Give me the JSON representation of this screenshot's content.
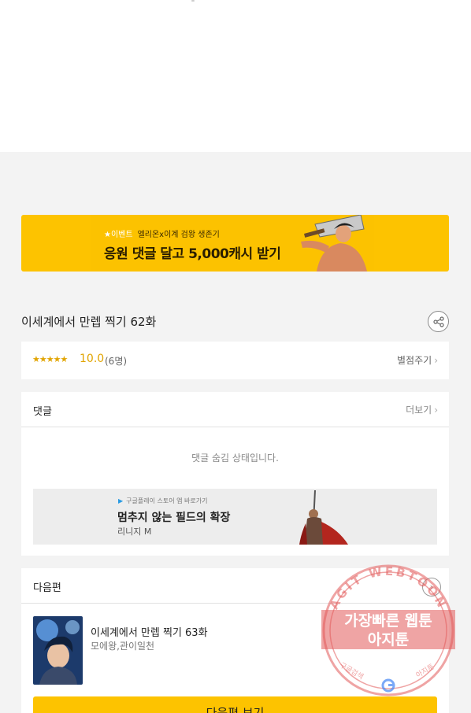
{
  "banner": {
    "tag": "★이벤트",
    "subtitle": "엘리온x이계 검왕 생존기",
    "headline": "응원 댓글 달고 5,000캐시 받기"
  },
  "episode": {
    "title": "이세계에서 만렙 찍기 62화",
    "share_icon": "share-icon"
  },
  "rating": {
    "stars": "★★★★★",
    "score": "10.0",
    "count": "(6명)",
    "rate_label": "별점주기",
    "chevron": "›"
  },
  "comments": {
    "title": "댓글",
    "more_label": "더보기",
    "chevron": "›",
    "hidden_message": "댓글 숨김 상태입니다."
  },
  "ad": {
    "store_line": "구글플레이 스토어 앱 바로가기",
    "title": "멈추지 않는 필드의 확장",
    "subtitle": "리니지 M"
  },
  "next": {
    "title": "다음편",
    "episode_title": "이세계에서 만렙 찍기 63화",
    "authors": "모에왕,관이일천",
    "button_label": "다음편 보기"
  },
  "watermark": {
    "arc_text": "AGIT WEBTOON",
    "line1": "가장빠른 웹툰",
    "line2": "아지툰",
    "bottom_left": "구글검색",
    "bottom_right": "아지툰"
  },
  "colors": {
    "accent": "#fdc300",
    "rating": "#e1a400",
    "background": "#f3f3f3",
    "stamp": "#e25a5a"
  }
}
